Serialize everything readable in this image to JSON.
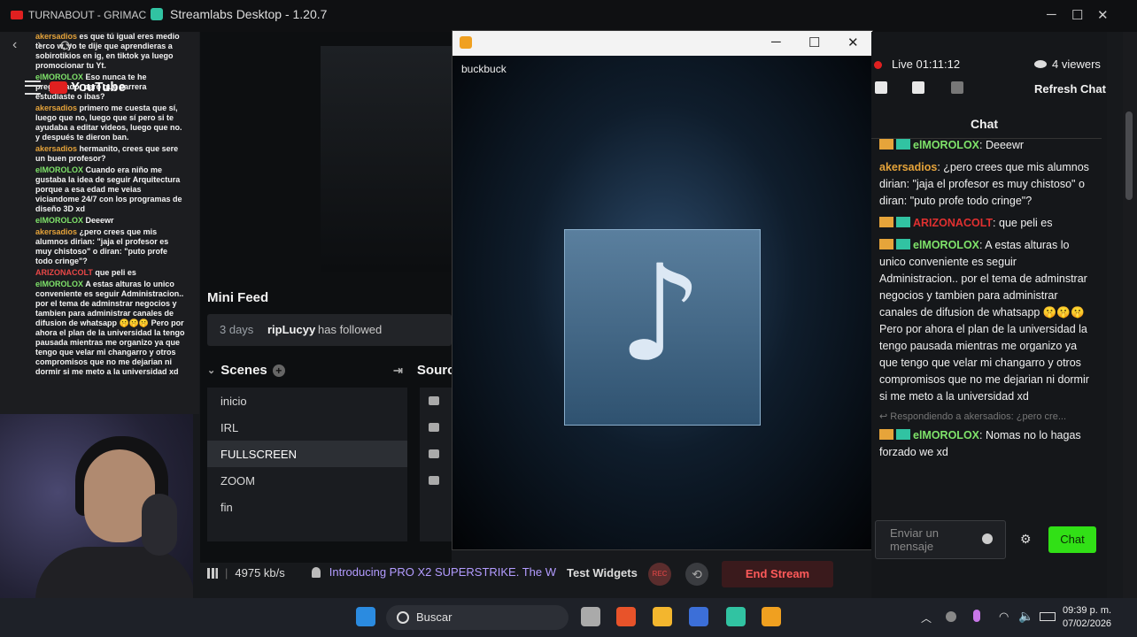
{
  "window": {
    "youtube_tab_label": "TURNABOUT - GRIMAC",
    "title": "Streamlabs Desktop - 1.20.7",
    "minimize": "─",
    "maximize": "☐",
    "close": "✕"
  },
  "browser": {
    "back": "‹",
    "forward": "›",
    "reload": "⟳",
    "youtube_logo": "YouTube"
  },
  "overlay_chat": [
    {
      "user": "akersadios",
      "text": "es que tú igual eres medio terco w, yo te dije que aprendieras a sobirotikios en ig, en tiktok ya luego promocionar tu Yt."
    },
    {
      "user": "elMOROLOX",
      "text": "Eso nunca te he preguntado, pero que carrera estudiaste o ibas?"
    },
    {
      "user": "akersadios",
      "text": "primero me cuesta que sí, luego que no, luego que sí pero si te ayudaba a editar videos, luego que no. y después te dieron ban."
    },
    {
      "user": "akersadios",
      "text": "hermanito, crees que sere un buen profesor?"
    },
    {
      "user": "elMOROLOX",
      "text": "Cuando era niño me gustaba la idea de seguir Arquitectura porque a esa edad me veias viciandome 24/7 con los programas de diseño 3D xd"
    },
    {
      "user": "elMOROLOX",
      "text": "Deeewr"
    },
    {
      "user": "akersadios",
      "text": "¿pero crees que mis alumnos dirian: \"jaja el profesor es muy chistoso\" o diran: \"puto profe todo cringe\"?"
    },
    {
      "user": "ARIZONACOLT",
      "text": "que peli es"
    },
    {
      "user": "elMOROLOX",
      "text": "A estas alturas lo unico conveniente es seguir Administracion.. por el tema de adminstrar negocios y tambien para administrar canales de difusion de whatsapp 🤫🤫🤫 Pero por ahora el plan de la universidad la tengo pausada mientras me organizo ya que tengo que velar mi changarro y otros compromisos que no me dejarian ni dormir si me meto a la universidad xd"
    }
  ],
  "minifeed": {
    "title": "Mini Feed",
    "days": "3 days",
    "user": "ripLucyy",
    "action": "has followed"
  },
  "scenes": {
    "title": "Scenes",
    "items": [
      "inicio",
      "IRL",
      "FULLSCREEN",
      "ZOOM",
      "fin"
    ],
    "selected_index": 2
  },
  "sources": {
    "title": "Sourc"
  },
  "footer": {
    "bitrate": "4975 kb/s",
    "promo": "Introducing PRO X2 SUPERSTRIKE. The W",
    "test_widgets": "Test Widgets",
    "rec": "REC",
    "end_stream": "End Stream"
  },
  "media_popup": {
    "filename": "buckbuck",
    "note_glyph": "♪",
    "minimize": "─",
    "maximize": "☐",
    "close": "✕"
  },
  "chat_panel": {
    "live": "Live 01:11:12",
    "viewers": "4 viewers",
    "refresh": "Refresh Chat",
    "title": "Chat",
    "messages": [
      {
        "user": "elMOROLOX",
        "color": "g",
        "badges": true,
        "text": ": Deeewr"
      },
      {
        "user": "akersadios",
        "color": "o",
        "badges": false,
        "text": ": ¿pero crees que mis alumnos dirian: \"jaja el profesor es muy chistoso\" o diran: \"puto profe todo cringe\"?"
      },
      {
        "user": "ARIZONACOLT",
        "color": "r",
        "badges": true,
        "text": ": que peli es"
      },
      {
        "user": "elMOROLOX",
        "color": "g",
        "badges": true,
        "text": ": A estas alturas lo unico conveniente es seguir Administracion.. por el tema de adminstrar negocios y tambien para administrar canales de difusion de whatsapp 🤫🤫🤫 Pero por ahora el plan de la universidad la tengo pausada mientras me organizo ya que tengo que velar mi changarro y otros compromisos que no me dejarian ni dormir si me meto a la universidad xd"
      }
    ],
    "reply_hint": "↩ Respondiendo a akersadios: ¿pero cre...",
    "last_message": {
      "user": "elMOROLOX",
      "text": ": Nomas no lo hagas forzado we xd"
    },
    "input_placeholder": "Enviar un mensaje",
    "send_label": "Chat"
  },
  "taskbar": {
    "search": "Buscar",
    "time": "09:39 p. m.",
    "date": "07/02/2026"
  }
}
